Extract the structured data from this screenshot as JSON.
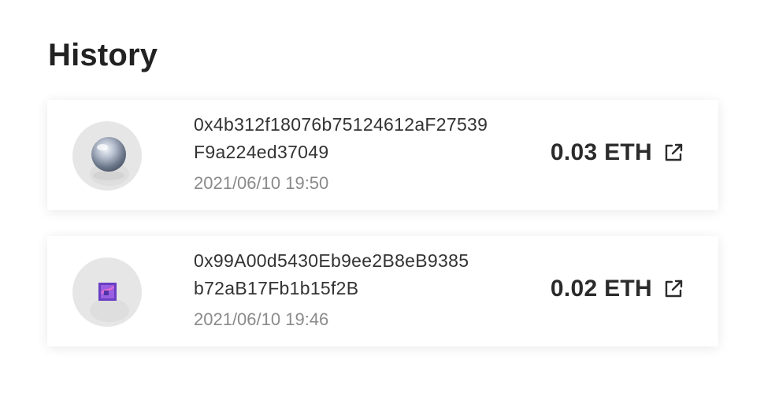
{
  "header": {
    "title": "History"
  },
  "transactions": [
    {
      "hash_line1": "0x4b312f18076b75124612aF27539",
      "hash_line2": "F9a224ed37049",
      "time": "2021/06/10 19:50",
      "amount": "0.03 ETH",
      "thumbnail": "silver-sphere-nft"
    },
    {
      "hash_line1": "0x99A00d5430Eb9ee2B8eB9385",
      "hash_line2": "b72aB17Fb1b15f2B",
      "time": "2021/06/10 19:46",
      "amount": "0.02 ETH",
      "thumbnail": "purple-square-nft"
    }
  ],
  "icons": {
    "external_link": "external-link-icon"
  },
  "colors": {
    "text_primary": "#222222",
    "text_secondary": "#8a8a8a",
    "card_background": "#ffffff",
    "avatar_background": "#e6e6e6",
    "nft_purple": "#7a4fd0"
  }
}
